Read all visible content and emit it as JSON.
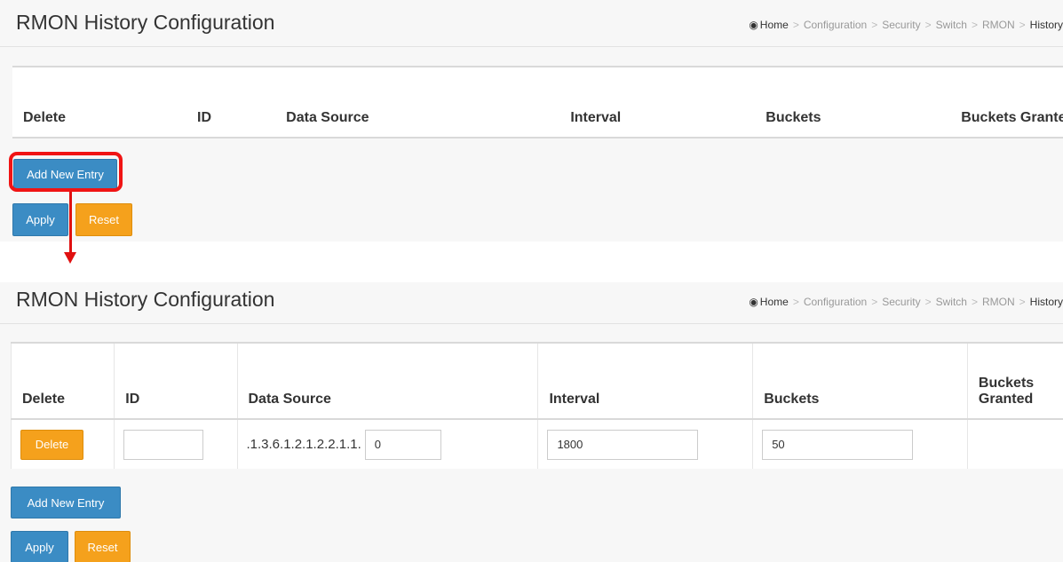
{
  "page_title": "RMON History Configuration",
  "breadcrumb": {
    "home": "Home",
    "items": [
      "Configuration",
      "Security",
      "Switch",
      "RMON"
    ],
    "current": "History",
    "separator": ">"
  },
  "table": {
    "headers": {
      "delete": "Delete",
      "id": "ID",
      "data_source": "Data Source",
      "interval": "Interval",
      "buckets": "Buckets",
      "buckets_granted": "Buckets Granted"
    }
  },
  "new_row": {
    "delete_label": "Delete",
    "id_value": "",
    "oid_prefix": ".1.3.6.1.2.1.2.2.1.1.",
    "data_source_value": "0",
    "interval_value": "1800",
    "buckets_value": "50",
    "buckets_granted_value": ""
  },
  "buttons": {
    "add_new_entry": "Add New Entry",
    "apply": "Apply",
    "reset": "Reset"
  },
  "colors": {
    "primary_button": "#3b8cc4",
    "warning_button": "#f5a11c",
    "annotation": "#e01010"
  }
}
